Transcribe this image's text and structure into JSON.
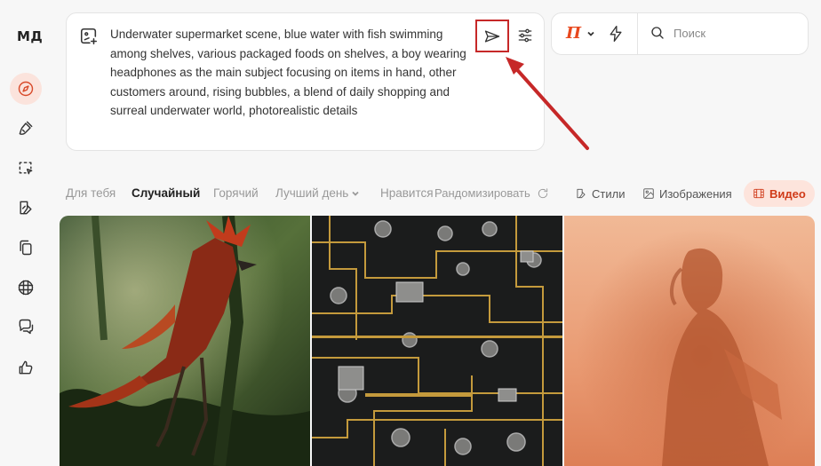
{
  "app": {
    "logo": "МД"
  },
  "sidebar": {
    "items": [
      {
        "icon": "compass-icon",
        "active": true
      },
      {
        "icon": "brush-icon",
        "active": false
      },
      {
        "icon": "select-dashed-icon",
        "active": false
      },
      {
        "icon": "edit-image-icon",
        "active": false
      },
      {
        "icon": "copy-icon",
        "active": false
      },
      {
        "icon": "grid-icon",
        "active": false
      },
      {
        "icon": "chat-icon",
        "active": false
      },
      {
        "icon": "thumbs-up-icon",
        "active": false
      }
    ]
  },
  "prompt": {
    "text": "Underwater supermarket scene, blue water with fish swimming among shelves, various packaged foods on shelves, a boy wearing headphones as the main subject focusing on items in hand, other customers around, rising bubbles, a blend of daily shopping and surreal underwater world, photorealistic details",
    "send_icon": "send-icon",
    "settings_icon": "sliders-icon"
  },
  "toolbar": {
    "model_letter": "П",
    "bolt_icon": "bolt-icon",
    "search_placeholder": "Поиск"
  },
  "tabs": [
    {
      "label": "Для тебя",
      "active": false
    },
    {
      "label": "Случайный",
      "active": true
    },
    {
      "label": "Горячий",
      "active": false
    },
    {
      "label": "Лучший день",
      "active": false,
      "dropdown": true
    },
    {
      "label": "Нравится",
      "active": false
    }
  ],
  "randomize_label": "Рандомизировать",
  "filters": [
    {
      "label": "Стили",
      "icon": "styles-icon",
      "active": false
    },
    {
      "label": "Изображения",
      "icon": "image-icon",
      "active": false
    },
    {
      "label": "Видео",
      "icon": "film-icon",
      "active": true
    }
  ],
  "colors": {
    "accent": "#e8481e",
    "active_bg": "#fbe3dc",
    "annotation": "#c62828"
  }
}
